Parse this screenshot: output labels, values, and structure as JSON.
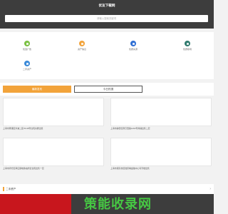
{
  "header": {
    "title": "优友下载网",
    "search_placeholder": "请输入搜索关键词"
  },
  "categories": [
    {
      "label": "优选广告",
      "icon": "category-icon",
      "color": "#7bc043"
    },
    {
      "label": "资产信息",
      "icon": "category-icon",
      "color": "#f2a33a"
    },
    {
      "label": "优质房源",
      "icon": "category-icon",
      "color": "#2f6fd4"
    },
    {
      "label": "优质职场",
      "icon": "category-icon",
      "color": "#2f7a6e"
    },
    {
      "label": "二手资产",
      "icon": "category-icon",
      "color": "#3a89d8"
    }
  ],
  "tabs": [
    {
      "label": "最新发布",
      "active": true
    },
    {
      "label": "今日热搜",
      "active": false
    }
  ],
  "listings": [
    {
      "title": "上海市黄浦区外滩二区78-99号住宅房屋出售"
    },
    {
      "title": "上海市静安区南京西路1260号商铺出售二层"
    },
    {
      "title": "上海市闵行区莘庄镇地铁站附近住宅出售一层"
    },
    {
      "title": "上海市浦东新区陆家嘴金融中心写字楼出售"
    }
  ],
  "section": {
    "title": "二手资产",
    "more": "›"
  },
  "watermark": {
    "text": "策能收录网"
  },
  "colors": {
    "header_bg": "#3d3d3d",
    "accent": "#f2a33a",
    "footer_red": "#c8161d"
  }
}
